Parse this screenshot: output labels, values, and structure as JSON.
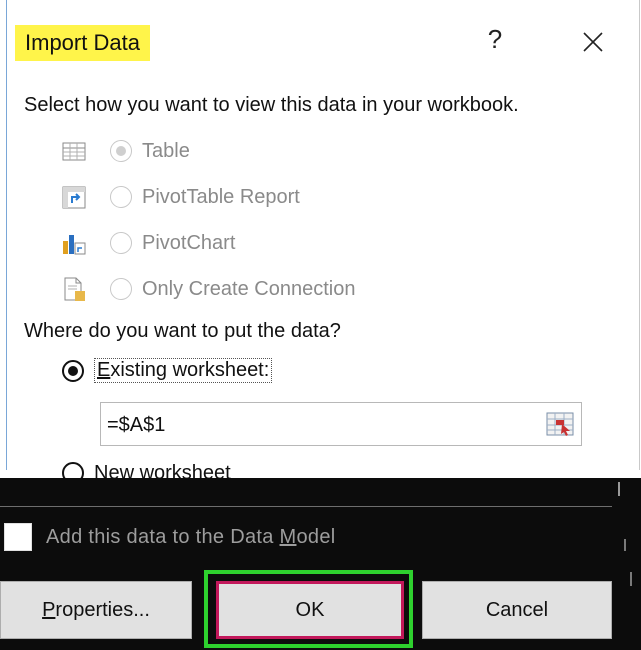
{
  "dialog": {
    "title": "Import Data",
    "help_label": "?",
    "instruction": "Select how you want to view this data in your workbook.",
    "view_options": [
      {
        "label": "Table",
        "icon": "table-icon",
        "selected": true
      },
      {
        "label": "PivotTable Report",
        "icon": "pivottable-icon",
        "selected": false
      },
      {
        "label": "PivotChart",
        "icon": "pivotchart-icon",
        "selected": false
      },
      {
        "label": "Only Create Connection",
        "icon": "connection-icon",
        "selected": false
      }
    ],
    "where_label": "Where do you want to put the data?",
    "existing_worksheet_label": "Existing worksheet:",
    "existing_worksheet_accel": "E",
    "existing_worksheet_rest": "xisting worksheet:",
    "range_value": "=$A$1",
    "new_worksheet_label": "New worksheet",
    "data_model_label_pre": "Add this data to the Data ",
    "data_model_accel": "M",
    "data_model_label_post": "odel",
    "buttons": {
      "properties_pre": "P",
      "properties_post": "roperties...",
      "ok": "OK",
      "cancel": "Cancel"
    }
  },
  "colors": {
    "title_highlight": "#fff44a",
    "ok_outline_green": "#2ed12e",
    "ok_border_magenta": "#c2185b",
    "button_face": "#e1e1e1",
    "disabled_text": "#8a8a8a"
  }
}
